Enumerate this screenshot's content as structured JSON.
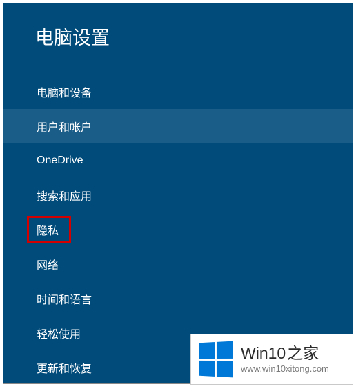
{
  "header": {
    "title": "电脑设置"
  },
  "nav": {
    "items": [
      {
        "label": "电脑和设备",
        "selected": false,
        "highlighted": false
      },
      {
        "label": "用户和帐户",
        "selected": true,
        "highlighted": false
      },
      {
        "label": "OneDrive",
        "selected": false,
        "highlighted": false
      },
      {
        "label": "搜索和应用",
        "selected": false,
        "highlighted": false
      },
      {
        "label": "隐私",
        "selected": false,
        "highlighted": true
      },
      {
        "label": "网络",
        "selected": false,
        "highlighted": false
      },
      {
        "label": "时间和语言",
        "selected": false,
        "highlighted": false
      },
      {
        "label": "轻松使用",
        "selected": false,
        "highlighted": false
      },
      {
        "label": "更新和恢复",
        "selected": false,
        "highlighted": false
      }
    ]
  },
  "watermark": {
    "brand_main": "Win10",
    "brand_suffix": "之家",
    "url": "www.win10xitong.com"
  }
}
